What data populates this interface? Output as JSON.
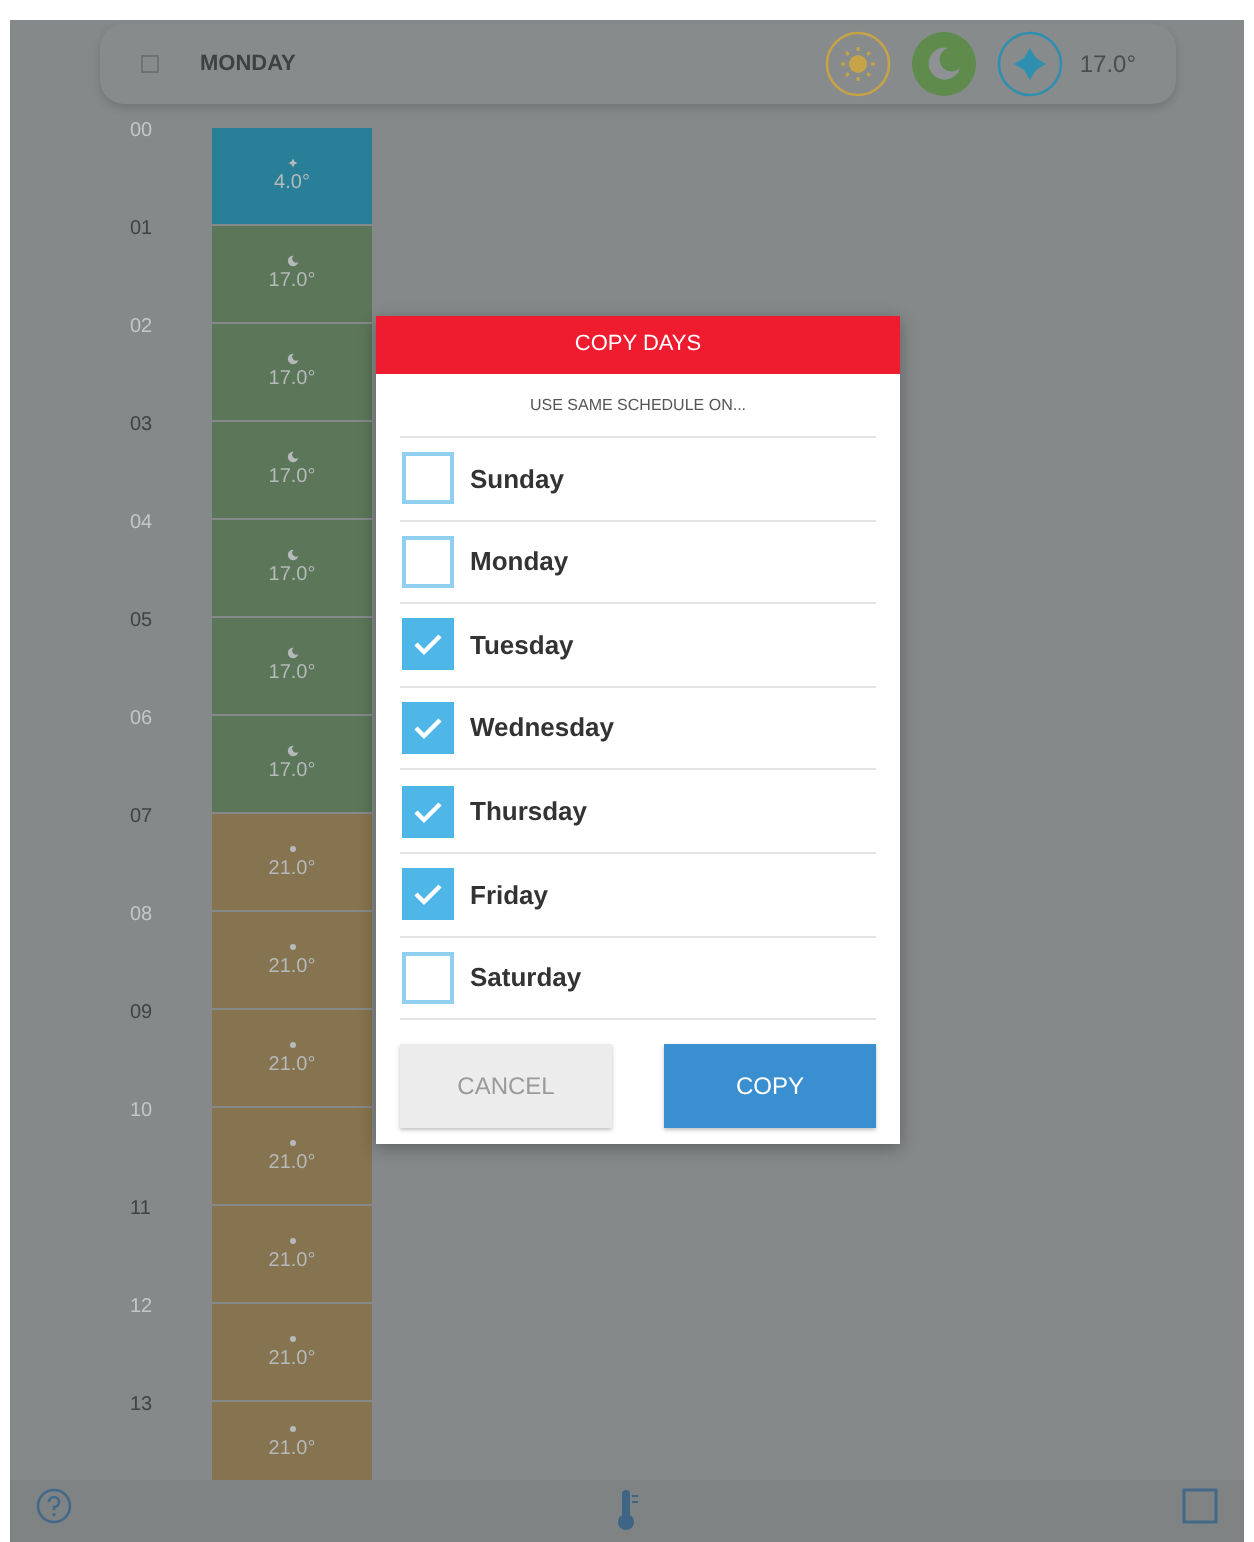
{
  "header": {
    "day": "MONDAY",
    "modes": [
      {
        "kind": "comfort",
        "selected": false
      },
      {
        "kind": "night",
        "selected": true
      },
      {
        "kind": "frost",
        "selected": false
      }
    ],
    "temperature": "17.0°"
  },
  "schedule": [
    {
      "hour": "00",
      "kind": "frost",
      "temp": "4.0°"
    },
    {
      "hour": "01",
      "kind": "night",
      "temp": "17.0°"
    },
    {
      "hour": "02",
      "kind": "night",
      "temp": "17.0°"
    },
    {
      "hour": "03",
      "kind": "night",
      "temp": "17.0°"
    },
    {
      "hour": "04",
      "kind": "night",
      "temp": "17.0°"
    },
    {
      "hour": "05",
      "kind": "night",
      "temp": "17.0°"
    },
    {
      "hour": "06",
      "kind": "night",
      "temp": "17.0°"
    },
    {
      "hour": "07",
      "kind": "comfort",
      "temp": "21.0°"
    },
    {
      "hour": "08",
      "kind": "comfort",
      "temp": "21.0°"
    },
    {
      "hour": "09",
      "kind": "comfort",
      "temp": "21.0°"
    },
    {
      "hour": "10",
      "kind": "comfort",
      "temp": "21.0°"
    },
    {
      "hour": "11",
      "kind": "comfort",
      "temp": "21.0°"
    },
    {
      "hour": "12",
      "kind": "comfort",
      "temp": "21.0°"
    },
    {
      "hour": "13",
      "kind": "comfort",
      "temp": "21.0°"
    }
  ],
  "dialog": {
    "title": "COPY DAYS",
    "subtitle": "USE SAME SCHEDULE ON...",
    "days": [
      {
        "label": "Sunday",
        "checked": false
      },
      {
        "label": "Monday",
        "checked": false
      },
      {
        "label": "Tuesday",
        "checked": true
      },
      {
        "label": "Wednesday",
        "checked": true
      },
      {
        "label": "Thursday",
        "checked": true
      },
      {
        "label": "Friday",
        "checked": true
      },
      {
        "label": "Saturday",
        "checked": false
      }
    ],
    "buttons": [
      {
        "label": "CANCEL",
        "kind": "secondary"
      },
      {
        "label": "COPY",
        "kind": "primary"
      }
    ]
  }
}
